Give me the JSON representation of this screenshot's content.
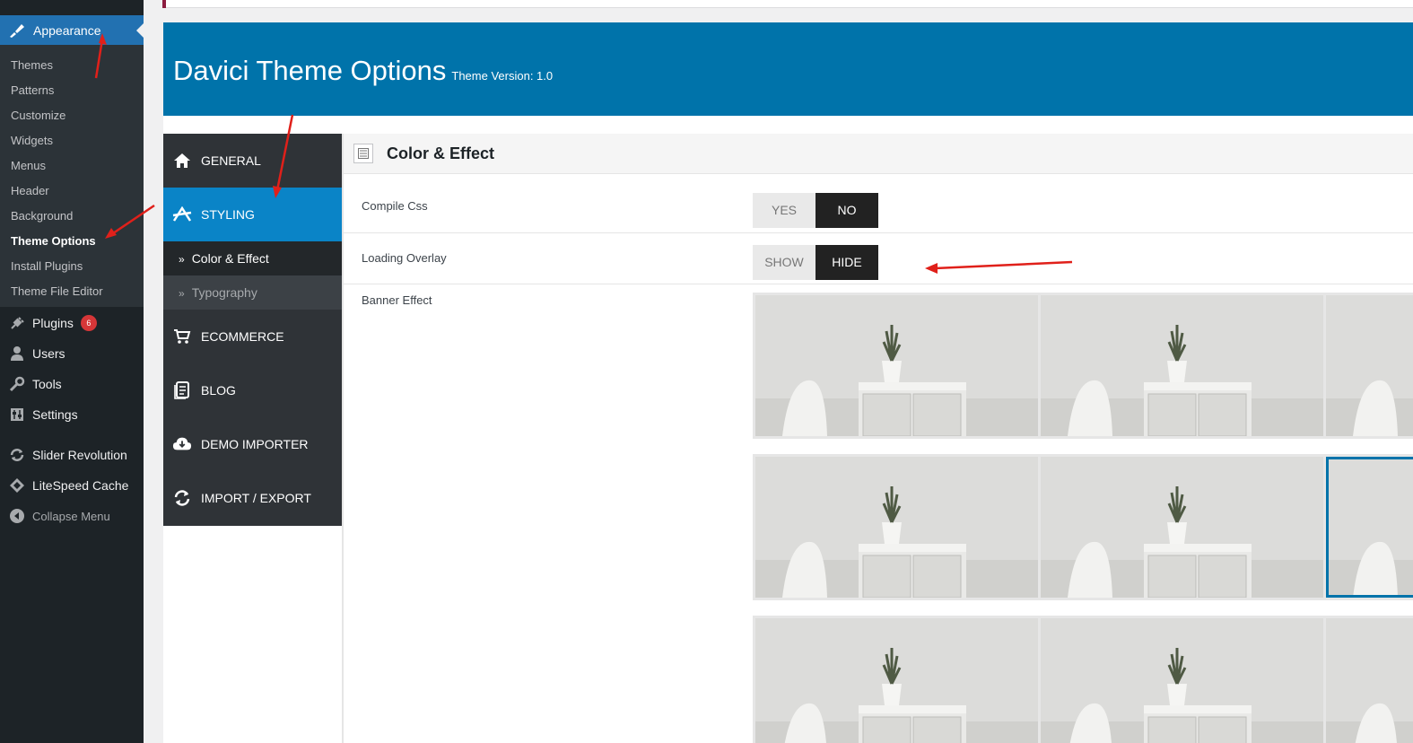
{
  "wp_sidebar": {
    "appearance_label": "Appearance",
    "submenu": [
      {
        "label": "Themes"
      },
      {
        "label": "Patterns"
      },
      {
        "label": "Customize"
      },
      {
        "label": "Widgets"
      },
      {
        "label": "Menus"
      },
      {
        "label": "Header"
      },
      {
        "label": "Background"
      },
      {
        "label": "Theme Options",
        "current": true
      },
      {
        "label": "Install Plugins"
      },
      {
        "label": "Theme File Editor"
      }
    ],
    "menu": [
      {
        "label": "Plugins",
        "icon": "plugin-icon",
        "badge": "6"
      },
      {
        "label": "Users",
        "icon": "users-icon"
      },
      {
        "label": "Tools",
        "icon": "wrench-icon"
      },
      {
        "label": "Settings",
        "icon": "settings-icon"
      },
      {
        "label": "Slider Revolution",
        "icon": "refresh-icon"
      },
      {
        "label": "LiteSpeed Cache",
        "icon": "diamond-icon"
      },
      {
        "label": "Collapse Menu",
        "icon": "collapse-icon"
      }
    ]
  },
  "header": {
    "title": "Davici Theme Options",
    "version": "Theme Version: 1.0",
    "color": "#0073aa"
  },
  "options_nav": {
    "items": [
      {
        "label": "GENERAL",
        "icon": "home-icon"
      },
      {
        "label": "STYLING",
        "icon": "styling-icon",
        "active": true
      },
      {
        "label": "ECOMMERCE",
        "icon": "cart-icon"
      },
      {
        "label": "BLOG",
        "icon": "blog-icon"
      },
      {
        "label": "DEMO IMPORTER",
        "icon": "cloud-download-icon"
      },
      {
        "label": "IMPORT / EXPORT",
        "icon": "sync-icon"
      }
    ],
    "sub_items": [
      {
        "label": "Color & Effect",
        "current": true
      },
      {
        "label": "Typography"
      }
    ],
    "subitem_marker": "»",
    "active_color": "#0a84c7"
  },
  "section": {
    "title": "Color & Effect",
    "options": {
      "compile_css": {
        "label": "Compile Css",
        "off": "YES",
        "on": "NO"
      },
      "loading_overlay": {
        "label": "Loading Overlay",
        "off": "SHOW",
        "on": "HIDE"
      },
      "banner_effect": {
        "label": "Banner Effect",
        "rows": 3,
        "per_row": 3,
        "selected_row": 2,
        "selected_col": 3
      }
    }
  },
  "annotations": {
    "arrow_color": "#e0201a"
  }
}
